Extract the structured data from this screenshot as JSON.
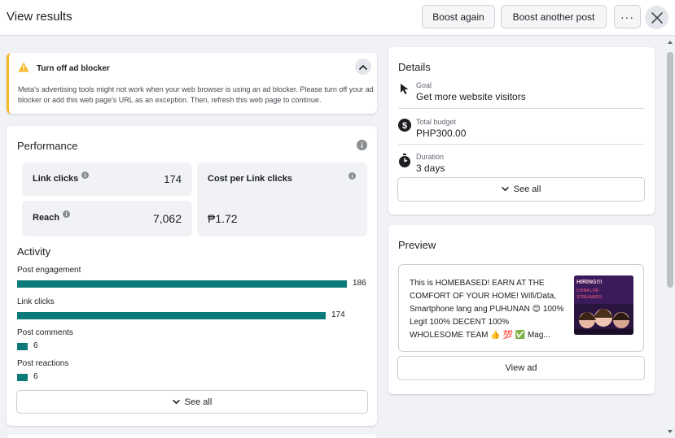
{
  "header": {
    "title": "View results",
    "boost_again": "Boost again",
    "boost_another": "Boost another post",
    "more": "···"
  },
  "warning": {
    "title": "Turn off ad blocker",
    "text": "Meta's advertising tools might not work when your web browser is using an ad blocker. Please turn off your ad blocker or add this web page's URL as an exception. Then, refresh this web page to continue."
  },
  "performance": {
    "title": "Performance",
    "metrics": {
      "link_clicks": {
        "label": "Link clicks",
        "value": "174"
      },
      "reach": {
        "label": "Reach",
        "value": "7,062"
      },
      "cost_per": {
        "label": "Cost per Link clicks",
        "value": "₱1.72"
      }
    },
    "activity_title": "Activity",
    "activity": [
      {
        "label": "Post engagement",
        "value": "186",
        "fraction": 1.0
      },
      {
        "label": "Link clicks",
        "value": "174",
        "fraction": 0.935
      },
      {
        "label": "Post comments",
        "value": "6",
        "fraction": 0.032
      },
      {
        "label": "Post reactions",
        "value": "6",
        "fraction": 0.032
      }
    ],
    "see_all": "See all"
  },
  "details": {
    "title": "Details",
    "rows": [
      {
        "label": "Goal",
        "value": "Get more website visitors",
        "icon": "cursor-icon"
      },
      {
        "label": "Total budget",
        "value": "PHP300.00",
        "icon": "dollar-icon"
      },
      {
        "label": "Duration",
        "value": "3 days",
        "icon": "stopwatch-icon"
      }
    ],
    "see_all": "See all"
  },
  "preview": {
    "title": "Preview",
    "ad_text": "This is HOMEBASED! EARN AT THE COMFORT OF YOUR HOME! Wifi/Data, Smartphone lang ang PUHUNAN 😊 100% Legit 100% DECENT 100% WHOLESOME TEAM 👍 💯 ✅ Mag...",
    "image_text": "HIRING!!! CHINA LIVE STREAMERS",
    "view_ad": "View ad"
  },
  "colors": {
    "accent_bar": "#0d7a7a",
    "warning": "#f7b928"
  }
}
